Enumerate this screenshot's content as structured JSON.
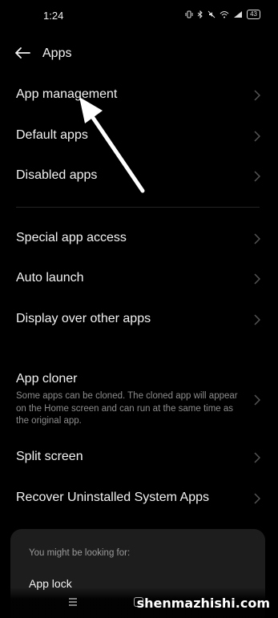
{
  "status_bar": {
    "time": "1:24",
    "icons": [
      "vibrate-icon",
      "bluetooth-icon",
      "mute-icon",
      "wifi-icon",
      "signal-icon"
    ],
    "battery": "43"
  },
  "header": {
    "title": "Apps"
  },
  "sections": [
    {
      "items": [
        {
          "label": "App management"
        },
        {
          "label": "Default apps"
        },
        {
          "label": "Disabled apps"
        }
      ]
    },
    {
      "items": [
        {
          "label": "Special app access"
        },
        {
          "label": "Auto launch"
        },
        {
          "label": "Display over other apps"
        }
      ]
    },
    {
      "items": [
        {
          "label": "App cloner",
          "description": "Some apps can be cloned. The cloned app will appear on the Home screen and can run at the same time as the original app."
        },
        {
          "label": "Split screen"
        },
        {
          "label": "Recover Uninstalled System Apps"
        }
      ]
    }
  ],
  "suggestions": {
    "title": "You might be looking for:",
    "items": [
      "App lock"
    ]
  },
  "watermark": "shenmazhishi.com",
  "colors": {
    "background": "#000000",
    "text": "#f2f2f2",
    "secondary": "#8c8c8c",
    "card": "#1d1d1d"
  }
}
